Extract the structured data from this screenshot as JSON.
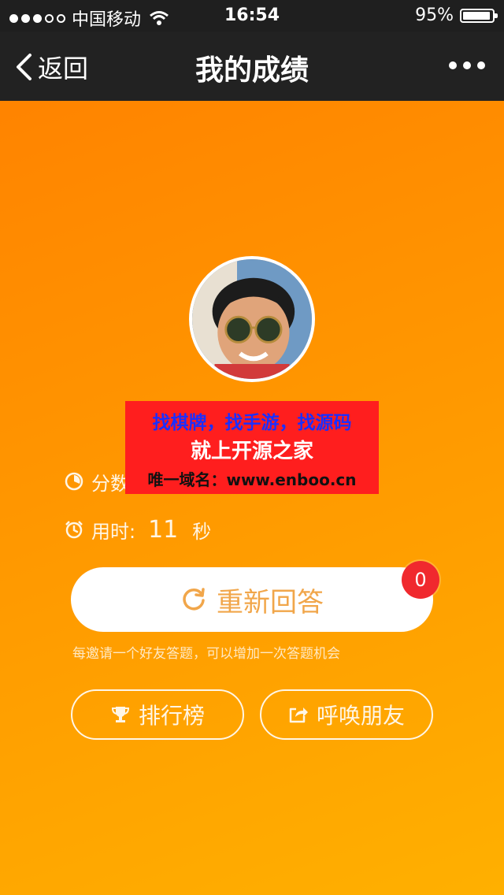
{
  "status_bar": {
    "carrier": "中国移动",
    "time": "16:54",
    "battery_percent_text": "95%",
    "battery_level": 0.95,
    "signal_dots_filled": 3,
    "signal_dots_total": 5
  },
  "nav": {
    "back_label": "返回",
    "title": "我的成绩"
  },
  "ad_banner": {
    "line1": "找棋牌，找手游，找源码",
    "line2": "就上开源之家",
    "line3": "唯一域名：www.enboo.cn"
  },
  "result": {
    "score_label": "分数",
    "time_label": "用时:",
    "time_value": "11",
    "time_unit": "秒"
  },
  "actions": {
    "retry_label": "重新回答",
    "retry_badge": "0",
    "hint": "每邀请一个好友答题，可以增加一次答题机会",
    "rank_label": "排行榜",
    "invite_label": "呼唤朋友"
  },
  "colors": {
    "gradient_start": "#ff7f00",
    "gradient_end": "#ffb000",
    "badge": "#f0292e",
    "retry_text": "#f1a64a"
  }
}
